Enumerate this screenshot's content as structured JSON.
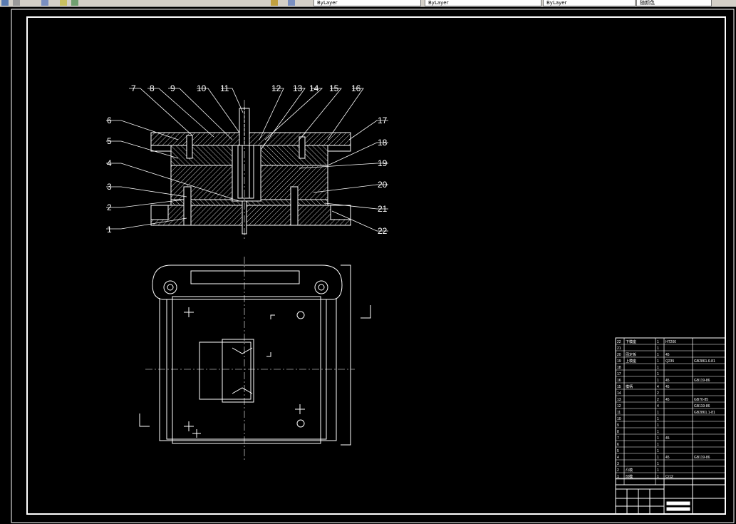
{
  "toolbar": {
    "layer_combo": "ByLayer",
    "linetype_combo": "ByLayer",
    "lineweight_combo": "ByLayer",
    "plotstyle_combo": "随颜色"
  },
  "drawing": {
    "part_numbers": [
      "1",
      "2",
      "3",
      "4",
      "5",
      "6",
      "7",
      "8",
      "9",
      "10",
      "11",
      "12",
      "13",
      "14",
      "15",
      "16",
      "17",
      "18",
      "19",
      "20",
      "21",
      "22"
    ]
  },
  "bom": {
    "row_numbers": [
      "22",
      "21",
      "20",
      "19",
      "18",
      "17",
      "16",
      "15",
      "14",
      "13",
      "12",
      "11",
      "10",
      "9",
      "8",
      "7",
      "6",
      "5",
      "4",
      "3",
      "2",
      "1"
    ],
    "names": [
      "下模座",
      "",
      "固定板",
      "上模座",
      "",
      "",
      "",
      "模柄",
      "",
      "",
      "",
      "",
      "",
      "",
      "",
      "",
      "",
      "",
      "",
      "",
      "凸模",
      "凹模"
    ],
    "qty": [
      "1",
      "1",
      "1",
      "1",
      "1",
      "1",
      "1",
      "4",
      "2",
      "2",
      "4",
      "1",
      "1",
      "1",
      "1",
      "1",
      "1",
      "1",
      "1",
      "1",
      "1",
      "1"
    ],
    "material": [
      "HT200",
      "",
      "45",
      "Q235",
      "",
      "",
      "45",
      "45",
      "",
      "45",
      "",
      "",
      "",
      "",
      "",
      "45",
      "",
      "",
      "45",
      "",
      "",
      "Cr12"
    ],
    "standard": [
      "",
      "",
      "",
      "GB2861.6-81",
      "",
      "",
      "GB119-86",
      "",
      "",
      "GB70-85",
      "GB119-86",
      "GB2861.1-81",
      "",
      "",
      "",
      "",
      "",
      "",
      "GB119-86",
      "",
      "",
      ""
    ]
  },
  "colors": {
    "background": "#000000",
    "lines": "#ffffff",
    "toolbar": "#d4d0c8"
  }
}
